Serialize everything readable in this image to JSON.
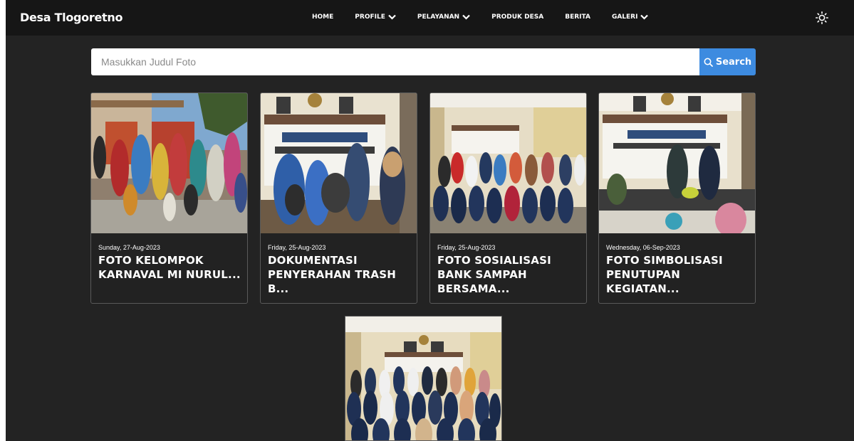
{
  "brand": "Desa Tlogoretno",
  "nav": {
    "items": [
      {
        "label": "HOME",
        "dropdown": false
      },
      {
        "label": "PROFILE",
        "dropdown": true
      },
      {
        "label": "PELAYANAN",
        "dropdown": true
      },
      {
        "label": "PRODUK DESA",
        "dropdown": false
      },
      {
        "label": "BERITA",
        "dropdown": false
      },
      {
        "label": "GALERI",
        "dropdown": true
      }
    ]
  },
  "search": {
    "placeholder": "Masukkan Judul Foto",
    "button_label": "Search"
  },
  "cards": [
    {
      "date": "Sunday, 27-Aug-2023",
      "title": "FOTO KELOMPOK KARNAVAL MI NURUL..."
    },
    {
      "date": "Friday, 25-Aug-2023",
      "title": "DOKUMENTASI PENYERAHAN TRASH B..."
    },
    {
      "date": "Friday, 25-Aug-2023",
      "title": "FOTO SOSIALISASI BANK SAMPAH BERSAMA..."
    },
    {
      "date": "Wednesday, 06-Sep-2023",
      "title": "FOTO SIMBOLISASI PENUTUPAN KEGIATAN..."
    }
  ],
  "icons": {
    "theme": "sun-icon",
    "search": "search-icon",
    "dropdown": "chevron-down-icon"
  },
  "colors": {
    "background": "#232323",
    "navbar": "#161616",
    "accent": "#3d8be0"
  }
}
